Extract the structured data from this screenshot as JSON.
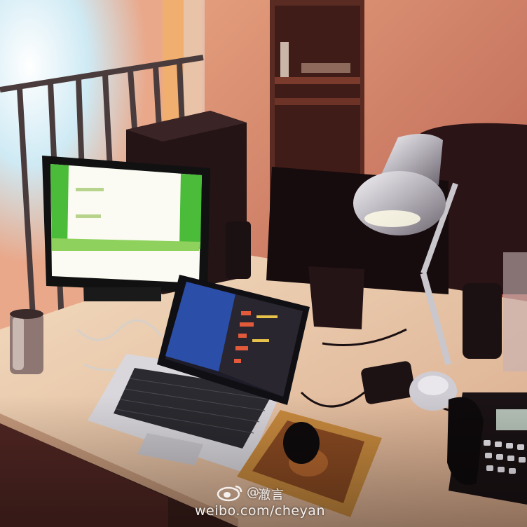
{
  "watermark": {
    "at_sign": "@",
    "handle": "澈言",
    "url": "weibo.com/cheyan",
    "logo_icon": "weibo-eye-icon"
  },
  "colors": {
    "wall": "#d98a73",
    "desk": "#e8c9a8",
    "window_glow": "#eaf6fb",
    "monitor_green": "#4bbb3a",
    "laptop_screen": "#2b4ea8",
    "lamp_silver": "#b9b6bc"
  }
}
